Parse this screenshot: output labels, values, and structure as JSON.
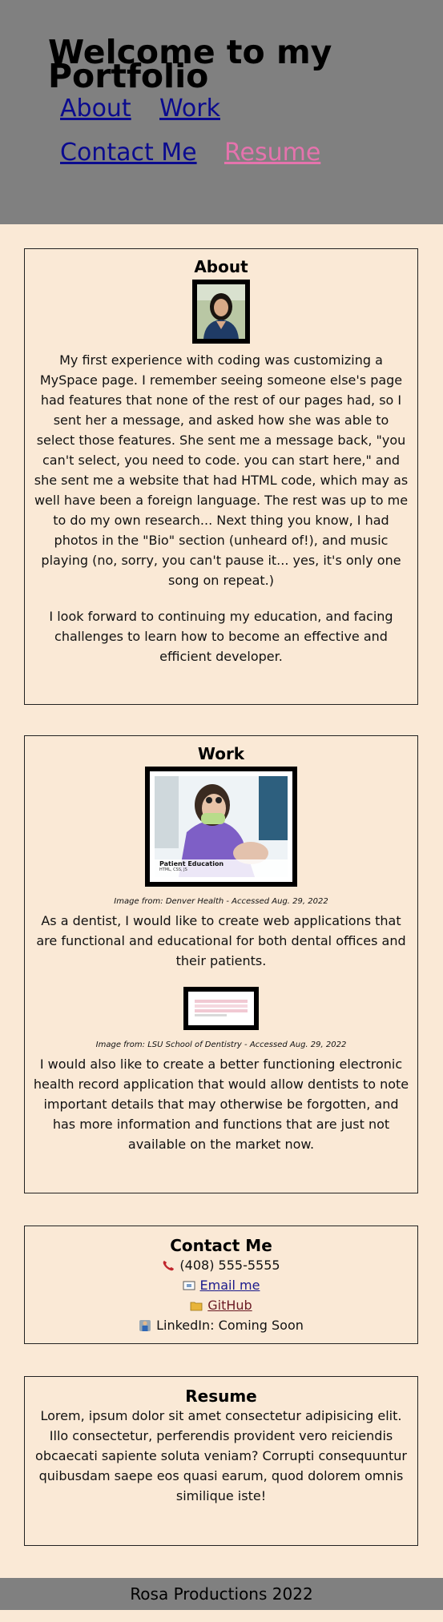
{
  "header": {
    "title": "Welcome to my Portfolio",
    "nav": {
      "about": "About",
      "work": "Work",
      "contact": "Contact Me",
      "resume": "Resume"
    }
  },
  "about": {
    "heading": "About",
    "paragraph1": "My first experience with coding was customizing a MySpace page. I remember seeing someone else's page had features that none of the rest of our pages had, so I sent her a message, and asked how she was able to select those features. She sent me a message back, \"you can't select, you need to code. you can start here,\" and she sent me a website that had HTML code, which may as well have been a foreign language. The rest was up to me to do my own research... Next thing you know, I had photos in the \"Bio\" section (unheard of!), and music playing (no, sorry, you can't pause it... yes, it's only one song on repeat.)",
    "paragraph2": "I look forward to continuing my education, and facing challenges to learn how to become an effective and efficient developer."
  },
  "work": {
    "heading": "Work",
    "image1_overlay_title": "Patient Education",
    "image1_overlay_sub": "HTML, CSS, JS",
    "caption1": "Image from: Denver Health - Accessed Aug. 29, 2022",
    "text1": "As a dentist, I would like to create web applications that are functional and educational for both dental offices and their patients.",
    "caption2": "Image from: LSU School of Dentistry - Accessed Aug. 29, 2022",
    "text2": "I would also like to create a better functioning electronic health record application that would allow dentists to note important details that may otherwise be forgotten, and has more information and functions that are just not available on the market now."
  },
  "contact": {
    "heading": "Contact Me",
    "phone": "(408) 555-5555",
    "email": "Email me",
    "github": "GitHub",
    "linkedin": "LinkedIn: Coming Soon"
  },
  "resume": {
    "heading": "Resume",
    "text": "Lorem, ipsum dolor sit amet consectetur adipisicing elit. Illo consectetur, perferendis provident vero reiciendis obcaecati sapiente soluta veniam? Corrupti consequuntur quibusdam saepe eos quasi earum, quod dolorem omnis similique iste!"
  },
  "footer": {
    "text": "Rosa Productions 2022"
  },
  "colors": {
    "page_background": "#fae9d6",
    "header_background": "#808080",
    "link": "#0b0b8f",
    "link_active": "#e573ad",
    "link_github": "#6b1a24"
  }
}
